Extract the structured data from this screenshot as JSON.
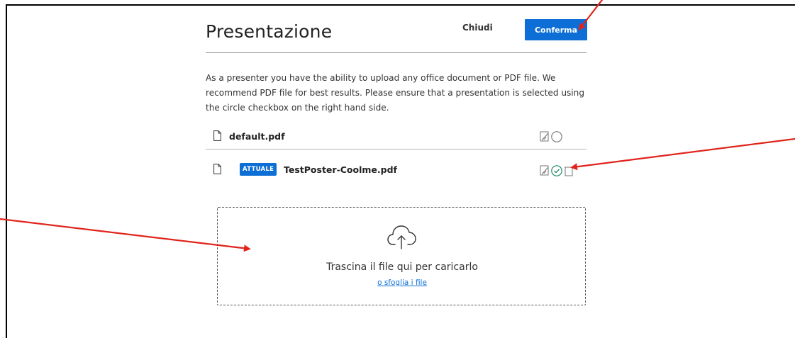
{
  "modal": {
    "title": "Presentazione",
    "close_label": "Chiudi",
    "confirm_label": "Conferma",
    "description": "As a presenter you have the ability to upload any office document or PDF file. We recommend PDF file for best results. Please ensure that a presentation is selected using the circle checkbox on the right hand side."
  },
  "files": [
    {
      "name": "default.pdf",
      "current": false,
      "selected": false
    },
    {
      "name": "TestPoster-Coolme.pdf",
      "current": true,
      "badge": "ATTUALE",
      "selected": true
    }
  ],
  "dropzone": {
    "text": "Trascina il file qui per caricarlo",
    "browse_link": "o sfoglia i file"
  },
  "colors": {
    "primary": "#0d6fd6",
    "selected_check": "#1a8a6a",
    "annotation_arrow": "#e0241b"
  },
  "icons": [
    "file-icon",
    "download-toggle-icon",
    "select-circle-icon",
    "check-circle-icon",
    "delete-icon",
    "upload-cloud-icon"
  ]
}
